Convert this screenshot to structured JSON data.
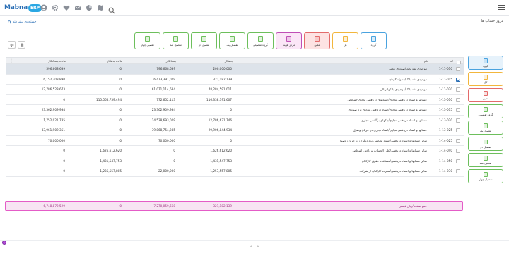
{
  "app": {
    "logo_text": "Mabna",
    "logo_badge": "ERP",
    "breadcrumb": "مرور حساب ها",
    "advanced_search": "جستجوی پیشرفته"
  },
  "colors": {
    "group": "#4aa3df",
    "kol": "#f2b63c",
    "moein": "#e36b6b",
    "markaz": "#c04fb6",
    "tafsili": "#6dbf5c",
    "accent": "#2b6fb5",
    "totals_border": "#e45cc7"
  },
  "group_buttons": [
    {
      "label": "گروه",
      "color": "#4aa3df",
      "bg": "#ffffff"
    },
    {
      "label": "کل",
      "color": "#f2b63c",
      "bg": "#ffffff"
    },
    {
      "label": "معین",
      "color": "#e36b6b",
      "bg": "#fde3e3"
    },
    {
      "label": "مرکز هزینه",
      "color": "#c04fb6",
      "bg": "#fbe6f7"
    },
    {
      "label": "گروه تفصیلی",
      "color": "#6dbf5c",
      "bg": "#ffffff"
    },
    {
      "label": "تفصیل یک",
      "color": "#6dbf5c",
      "bg": "#ffffff"
    },
    {
      "label": "تفصیل دو",
      "color": "#6dbf5c",
      "bg": "#ffffff"
    },
    {
      "label": "تفصیل سه",
      "color": "#6dbf5c",
      "bg": "#ffffff"
    },
    {
      "label": "تفصیل چهار",
      "color": "#6dbf5c",
      "bg": "#ffffff"
    }
  ],
  "sidebar": [
    {
      "label": "گروه",
      "color": "#4aa3df",
      "bg": "#e6f2fb"
    },
    {
      "label": "کل",
      "color": "#f2b63c",
      "bg": "#ffffff"
    },
    {
      "label": "معین",
      "color": "#e36b6b",
      "bg": "#ffffff"
    },
    {
      "label": "گروه تفصیلی",
      "color": "#6dbf5c",
      "bg": "#ffffff"
    },
    {
      "label": "تفصیل یک",
      "color": "#6dbf5c",
      "bg": "#ffffff"
    },
    {
      "label": "تفصیل دو",
      "color": "#6dbf5c",
      "bg": "#ffffff"
    },
    {
      "label": "تفصیل سه",
      "color": "#6dbf5c",
      "bg": "#ffffff"
    },
    {
      "label": "تفصیل چهار",
      "color": "#6dbf5c",
      "bg": "#ffffff"
    }
  ],
  "table": {
    "headers": {
      "code": "کد",
      "name": "نام",
      "debit": "بدهکار",
      "credit": "بستانکار",
      "balance_debit": "مانده بدهکار",
      "balance_credit": "مانده بستانکار"
    },
    "rows": [
      {
        "code": "1-11-010",
        "name": "موجودی نقد بانک/صندوق ریالی",
        "debit": "200,000,000",
        "credit": "796,668,639",
        "balance_debit": "0",
        "balance_credit": "596,668,639",
        "selected": true,
        "checked": false
      },
      {
        "code": "1-11-015",
        "name": "موجودی نقد بانک/تنخواه گردان",
        "debit": "321,182,139",
        "credit": "6,473,391,029",
        "balance_debit": "0",
        "balance_credit": "6,152,203,890",
        "selected": false,
        "checked": true
      },
      {
        "code": "1-11-020",
        "name": "موجودی نقد بانک/موجودی بانکها ریالی",
        "debit": "48,284,591,011",
        "credit": "61,071,114,684",
        "balance_debit": "0",
        "balance_credit": "12,786,523,673",
        "selected": false,
        "checked": false
      },
      {
        "code": "1-13-010",
        "name": "حسابها و اسناد دریافتنی تجاری/حسابهای دریافتنی تجاری-اشخاص",
        "debit": "116,338,391,607",
        "credit": "772,652,113",
        "balance_debit": "115,565,739,494",
        "balance_credit": "0",
        "selected": false,
        "checked": false
      },
      {
        "code": "1-13-015",
        "name": "حسابها و اسناد دریافتنی تجاری/اسناد دریافتنی تجاری نزد صندوق",
        "debit": "0",
        "credit": "23,362,909,934",
        "balance_debit": "0",
        "balance_credit": "23,362,909,934",
        "selected": false,
        "checked": false
      },
      {
        "code": "1-13-020",
        "name": "حسابها و اسناد دریافتنی تجاری/چکهای برگشتی تجاری",
        "debit": "12,786,671,746",
        "credit": "14,538,693,029",
        "balance_debit": "0",
        "balance_credit": "1,752,021,785",
        "selected": false,
        "checked": false
      },
      {
        "code": "1-13-025",
        "name": "حسابها و اسناد دریافتنی تجاری/اسناد تجاری در جریان وصول",
        "debit": "29,906,844,934",
        "credit": "39,868,754,285",
        "balance_debit": "0",
        "balance_credit": "33,961,909,351",
        "selected": false,
        "checked": false
      },
      {
        "code": "1-14-025",
        "name": "سایر حسابها و اسناد دریافتنی/اسناد تضامنی نزد دیگران در جریان وصول",
        "debit": "0",
        "credit": "70,000,000",
        "balance_debit": "0",
        "balance_credit": "70,000,000",
        "selected": false,
        "checked": false
      },
      {
        "code": "1-14-040",
        "name": "سایر حسابها و اسناد دریافتنی/علی الحساب پرداختی اشخاص",
        "debit": "1,626,612,620",
        "credit": "0",
        "balance_debit": "1,626,612,620",
        "selected": false,
        "checked": false,
        "balance_credit": "0"
      },
      {
        "code": "1-14-050",
        "name": "سایر حسابها و اسناد دریافتنی/مساعده حقوق کارکنان",
        "debit": "1,431,547,753",
        "credit": "0",
        "balance_debit": "1,431,547,753",
        "balance_credit": "0",
        "selected": false,
        "checked": false
      },
      {
        "code": "1-14-070",
        "name": "سایر حسابها و اسناد دریافتنی/سپرده کارکنان از شرکت",
        "debit": "1,257,557,805",
        "credit": "22,000,000",
        "balance_debit": "1,235,557,805",
        "balance_credit": "0",
        "selected": false,
        "checked": false
      }
    ]
  },
  "totals": {
    "label": "جمع صفحه/ریال-قیمتی",
    "debit": "321,182,139",
    "credit": "7,270,059,668",
    "balance_debit": "0",
    "balance_credit": "6,748,872,529"
  },
  "pagination": {
    "prev": "«",
    "next": "»"
  }
}
